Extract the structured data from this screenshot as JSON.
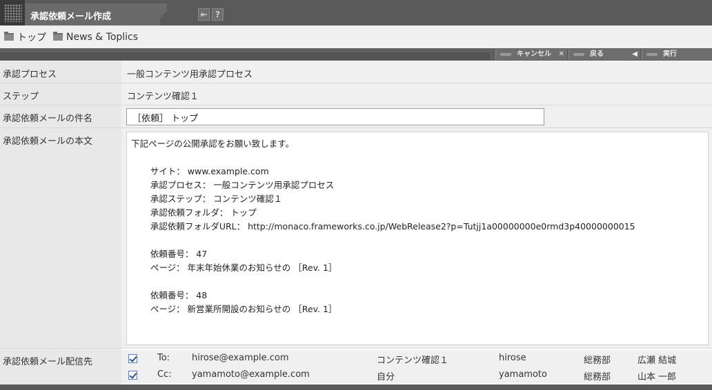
{
  "window": {
    "title": "承認依頼メール作成"
  },
  "breadcrumb": [
    {
      "label": "トップ"
    },
    {
      "label": "News & Toplics"
    }
  ],
  "toolbar": {
    "cancel_label": "キャンセル",
    "back_label": "戻る",
    "execute_label": "実行"
  },
  "form": {
    "process_label": "承認プロセス",
    "process_value": "一般コンテンツ用承認プロセス",
    "step_label": "ステップ",
    "step_value": "コンテンツ確認１",
    "subject_label": "承認依頼メールの件名",
    "subject_value": "［依頼］ トップ",
    "body_label": "承認依頼メールの本文",
    "body_value": "下記ページの公開承認をお願い致します。\n\n       サイト： www.example.com\n       承認プロセス： 一般コンテンツ用承認プロセス\n       承認ステップ： コンテンツ確認１\n       承認依頼フォルダ： トップ\n       承認依頼フォルダURL： http://monaco.frameworks.co.jp/WebRelease2?p=Tutjj1a00000000e0rmd3p40000000015\n\n       依頼番号： 47\n       ページ： 年末年始休業のお知らせの ［Rev. 1］\n\n       依頼番号： 48\n       ページ： 新営業所開設のお知らせの ［Rev. 1］",
    "recipients_label": "承認依頼メール配信先"
  },
  "recipients": [
    {
      "type": "To:",
      "email": "hirose@example.com",
      "step": "コンテンツ確認１",
      "user": "hirose",
      "dept": "総務部",
      "name": "広瀬 結城",
      "checked": true
    },
    {
      "type": "Cc:",
      "email": "yamamoto@example.com",
      "step": "自分",
      "user": "yamamoto",
      "dept": "総務部",
      "name": "山本 一郎",
      "checked": true
    }
  ],
  "icons": {
    "back": "return-arrow-icon",
    "help": "question-icon"
  }
}
